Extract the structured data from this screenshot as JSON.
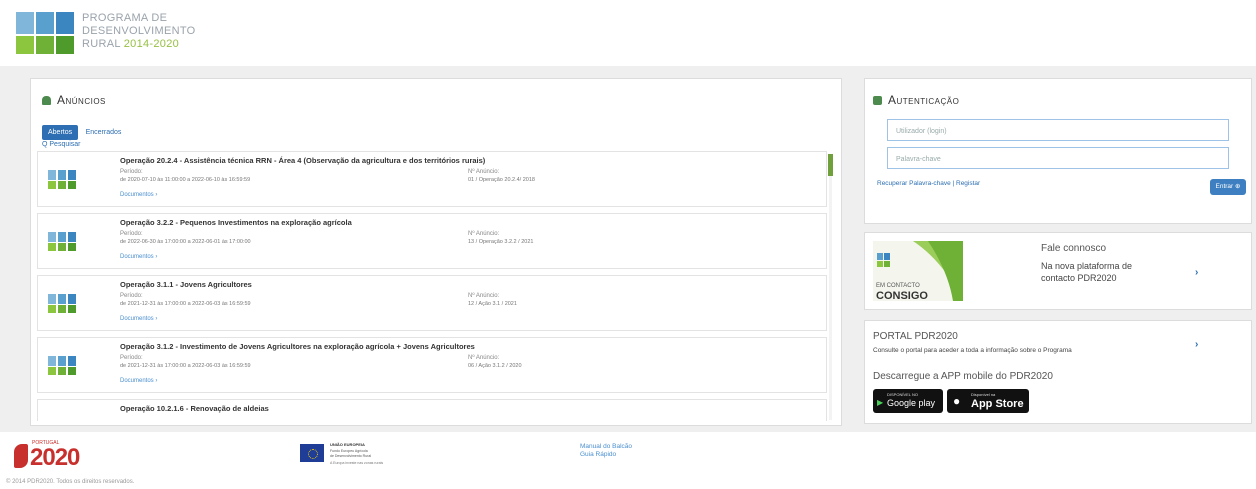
{
  "header": {
    "logo_text_line1": "PROGRAMA DE",
    "logo_text_line2": "DESENVOLVIMENTO",
    "logo_text_rural": "RURAL ",
    "logo_text_years": "2014-2020"
  },
  "announcements": {
    "title": "Anúncios",
    "tab_open": "Abertos",
    "tab_closed": "Encerrados",
    "search": "Q  Pesquisar",
    "period_label": "Período:",
    "number_label": "Nº Anúncio:",
    "docs_label": "Documentos ›",
    "items": [
      {
        "title": "Operação 20.2.4 - Assistência técnica RRN - Área 4 (Observação da agricultura e dos territórios rurais)",
        "period": "de 2020-07-10 às 11:00:00 a 2022-06-10 às 16:59:59",
        "number": "01 / Operação 20.2.4/ 2018"
      },
      {
        "title": "Operação 3.2.2 - Pequenos Investimentos na exploração agrícola",
        "period": "de 2022-06-30 às 17:00:00 a 2022-06-01 às 17:00:00",
        "number": "13 / Operação 3.2.2 / 2021"
      },
      {
        "title": "Operação 3.1.1 - Jovens Agricultores",
        "period": "de 2021-12-31 às 17:00:00 a 2022-06-03 às 16:59:59",
        "number": "12 / Ação 3.1 / 2021"
      },
      {
        "title": "Operação 3.1.2 - Investimento de Jovens Agricultores na exploração agrícola + Jovens Agricultores",
        "period": "de 2021-12-31 às 17:00:00 a 2022-06-03 às 16:59:59",
        "number": "06 / Ação 3.1.2 / 2020"
      },
      {
        "title": "Operação 10.2.1.6 - Renovação de aldeias",
        "period": "",
        "number": ""
      }
    ]
  },
  "auth": {
    "title": "Autenticação",
    "user_placeholder": "Utilizador (login)",
    "password_placeholder": "Palavra-chave",
    "recover_link": "Recuperar Palavra-chave | Registar",
    "submit": "Entrar ⊕"
  },
  "contact": {
    "img_caption_line1": "EM CONTACTO",
    "img_caption_line2": "CONSIGO",
    "title": "Fale connosco",
    "line1": "Na nova plataforma de",
    "line2": "contacto PDR2020"
  },
  "portal": {
    "title": "PORTAL PDR2020",
    "desc": "Consulte o portal para aceder a toda a informação sobre o Programa",
    "app_title": "Descarregue a APP mobile do PDR2020",
    "google_small": "DISPONÍVEL NO",
    "google_big": "Google play",
    "apple_small": "Disponível na",
    "apple_big": "App Store"
  },
  "footer": {
    "portugal_label": "PORTUGAL",
    "portugal_year": "2020",
    "eu_label": "UNIÃO EUROPEIA",
    "eu_sub1": "Fundo Europeu Agrícola",
    "eu_sub2": "de Desenvolvimento Rural",
    "eu_sub3": "A Europa investe nas zonas rurais",
    "manual_link": "Manual do Balcão",
    "guide_link": "Guia Rápido",
    "copyright": "© 2014 PDR2020. Todos os direitos reservados."
  },
  "colors": {
    "brand_blue": "#2d6fb2",
    "brand_green": "#6fa03c"
  }
}
